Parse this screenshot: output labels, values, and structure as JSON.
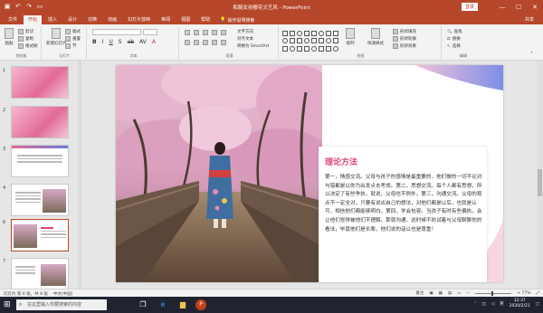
{
  "titlebar": {
    "title": "和服女孩樱花文艺风 - PowerPoint",
    "signin": "登录",
    "qat_icons": [
      "save-icon",
      "undo-icon",
      "redo-icon",
      "present-icon"
    ],
    "window_buttons": [
      "—",
      "☐",
      "✕"
    ]
  },
  "tabs": {
    "items": [
      "文件",
      "开始",
      "插入",
      "设计",
      "切换",
      "动画",
      "幻灯片放映",
      "审阅",
      "视图",
      "帮助"
    ],
    "active_index": 1,
    "tellme": "操作说明搜索",
    "share": "共享"
  },
  "ribbon": {
    "clipboard": {
      "label": "剪贴板",
      "paste": "粘贴",
      "cut": "剪切",
      "copy": "复制",
      "format": "格式刷"
    },
    "slides": {
      "label": "幻灯片",
      "new_slide": "新建幻灯片",
      "layout": "版式",
      "reset": "重置",
      "section": "节"
    },
    "font": {
      "label": "字体",
      "font_name": "",
      "font_size": ""
    },
    "paragraph": {
      "label": "段落",
      "text_direction": "文字方向",
      "align_text": "对齐文本",
      "smartart": "转换为 SmartArt"
    },
    "drawing": {
      "label": "绘图",
      "arrange": "排列",
      "quick_styles": "快速样式",
      "fill": "形状填充",
      "outline": "形状轮廓",
      "effects": "形状效果"
    },
    "editing": {
      "label": "编辑",
      "find": "查找",
      "replace": "替换",
      "select": "选择"
    }
  },
  "thumbnails": [
    {
      "num": "1",
      "text": ""
    },
    {
      "num": "2",
      "text": ""
    },
    {
      "num": "3",
      "text": ""
    },
    {
      "num": "4",
      "text": ""
    },
    {
      "num": "5",
      "text": ""
    },
    {
      "num": "6",
      "text": ""
    },
    {
      "num": "7",
      "text": ""
    }
  ],
  "slide": {
    "heading": "理论方法",
    "body": "第一，情感交流。父母与孩子的感情是最重要的，他们做的一切不论对与错都是以你为出发点去考虑。第二，思想交流。每个人都有思想，所以决定了有些争执，就说，父母也不例外。第三，沟通交流。父母的观点不一定全对，只要有说出自己的想法，对他们都是以后，也就是认可，相信他们都能够明白。第四，学会包容。当孩子有时有些偏执，会让他们觉得被他们不理解，那就沟通，这时候不妨试着与父母聊聊你的看法，毕竟他们是长辈，他们说的话以也是尊重！"
  },
  "statusbar": {
    "slide_info": "幻灯片 第 6 张，共 8 张",
    "language": "中文(中国)",
    "notes": "备注",
    "zoom": "+ 77%"
  },
  "taskbar": {
    "search_placeholder": "在这里输入你要搜索的内容",
    "time": "12:37",
    "date": "2020/2/21",
    "lang": "英"
  },
  "colors": {
    "accent": "#b7472a",
    "heading_pink": "#e0447a",
    "swoosh_start": "#7e8ee8",
    "swoosh_end": "#f4c3d9"
  }
}
